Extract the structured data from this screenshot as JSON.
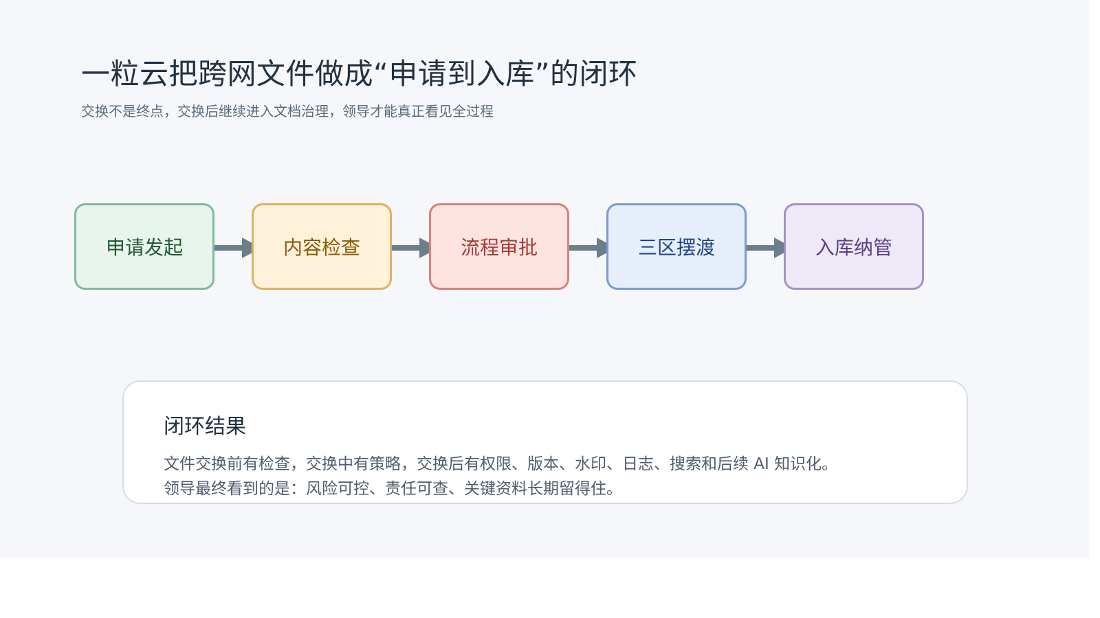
{
  "header": {
    "title": "一粒云把跨网文件做成“申请到入库”的闭环",
    "subtitle": "交换不是终点，交换后继续进入文档治理，领导才能真正看见全过程"
  },
  "flow": {
    "steps": [
      {
        "label": "申请发起",
        "bg": "#e8f5ec",
        "border": "#7fb89a",
        "text": "#1f5a34"
      },
      {
        "label": "内容检查",
        "bg": "#fff1da",
        "border": "#e0b15c",
        "text": "#8a5a06"
      },
      {
        "label": "流程审批",
        "bg": "#fde4e1",
        "border": "#da8077",
        "text": "#a83a32"
      },
      {
        "label": "三区摆渡",
        "bg": "#e6eefa",
        "border": "#7a9ad0",
        "text": "#21448a"
      },
      {
        "label": "入库纳管",
        "bg": "#efe8f7",
        "border": "#a591c6",
        "text": "#5a3d82"
      }
    ],
    "arrow_color": "#6b7f8a"
  },
  "result": {
    "title": "闭环结果",
    "lines": [
      "文件交换前有检查，交换中有策略，交换后有权限、版本、水印、日志、搜索和后续 AI 知识化。",
      "领导最终看到的是：风险可控、责任可查、关键资料长期留得住。"
    ]
  }
}
